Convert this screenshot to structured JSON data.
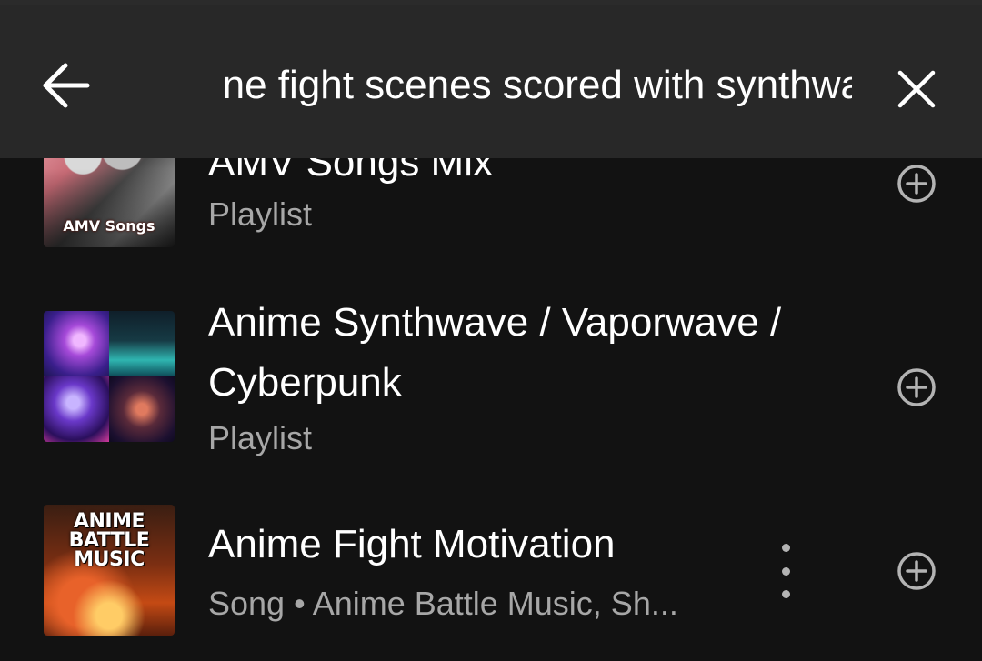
{
  "search": {
    "query": "ne fight scenes scored with synthway"
  },
  "results": [
    {
      "title": "AMV Songs Mix",
      "subtitle": "Playlist",
      "thumb_text": "AMV Songs"
    },
    {
      "title_line1": "Anime Synthwave / Vaporwave /",
      "title_line2": "Cyberpunk",
      "subtitle": "Playlist"
    },
    {
      "title": "Anime Fight Motivation",
      "subtitle": "Song • Anime Battle Music, Sh...",
      "thumb_text_lines": [
        "ANIME",
        "BATTLE",
        "MUSIC"
      ]
    }
  ],
  "icons": {
    "back": "arrow-left-icon",
    "clear": "close-icon",
    "add": "plus-circle-icon",
    "more": "more-vertical-icon"
  },
  "colors": {
    "background": "#121212",
    "search_bar": "#282828",
    "text_primary": "#ffffff",
    "text_secondary": "#a7a7a7"
  }
}
